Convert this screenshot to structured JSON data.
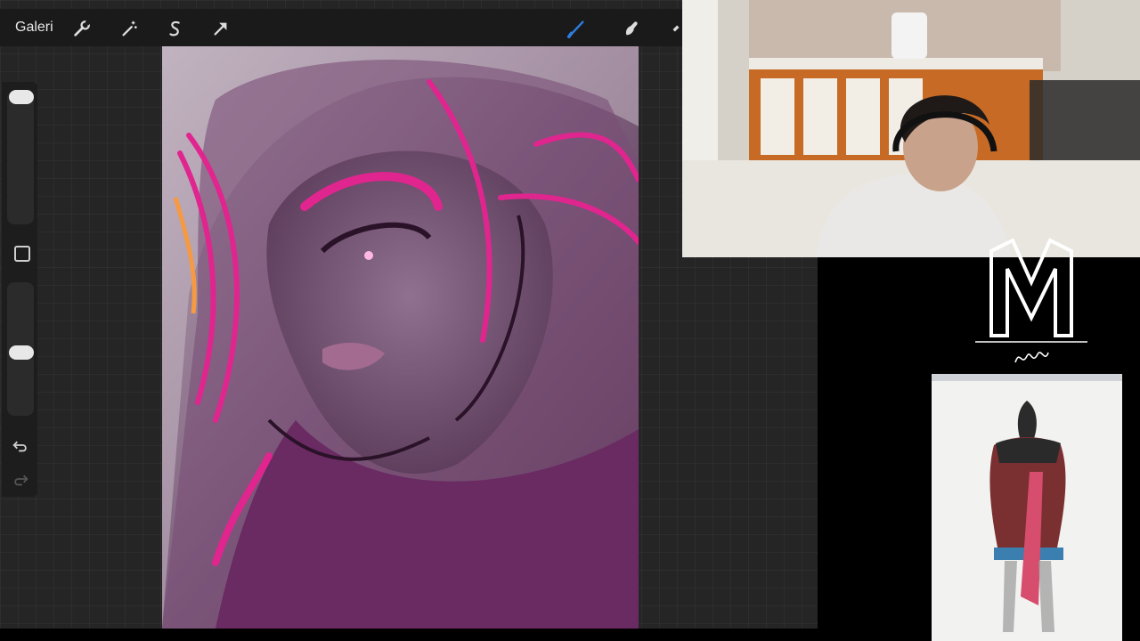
{
  "toolbar": {
    "gallery_label": "Galeri",
    "tools": [
      "wrench-icon",
      "magic-wand-icon",
      "selection-icon",
      "transform-arrow-icon",
      "brush-icon",
      "smudge-icon"
    ],
    "active_tool": "brush-icon",
    "accent_color": "#2d7de0"
  },
  "sidebar": {
    "controls": [
      "brush-size-slider",
      "modify-button",
      "opacity-slider",
      "undo-icon",
      "redo-icon"
    ]
  },
  "canvas": {
    "description_colors": {
      "background": "#8a6c86",
      "accent": "#e0258f"
    }
  },
  "overlay": {
    "logo_signature": "Murat"
  }
}
